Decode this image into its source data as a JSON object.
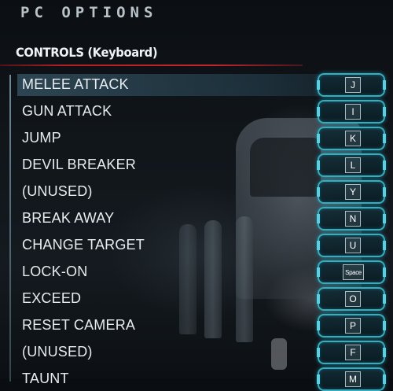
{
  "header": {
    "title": "PC OPTIONS",
    "section": "CONTROLS (Keyboard)"
  },
  "colors": {
    "accent_cyan": "#2fb0c4",
    "section_underline_red": "#c4262e",
    "selected_row": "#46778c"
  },
  "controls": {
    "rows": [
      {
        "action": "MELEE ATTACK",
        "key": "J",
        "selected": true
      },
      {
        "action": "GUN ATTACK",
        "key": "I"
      },
      {
        "action": "JUMP",
        "key": "K"
      },
      {
        "action": "DEVIL BREAKER",
        "key": "L"
      },
      {
        "action": "(UNUSED)",
        "key": "Y"
      },
      {
        "action": "BREAK AWAY",
        "key": "N"
      },
      {
        "action": "CHANGE TARGET",
        "key": "U"
      },
      {
        "action": "LOCK-ON",
        "key": "Space"
      },
      {
        "action": "EXCEED",
        "key": "O"
      },
      {
        "action": "RESET CAMERA",
        "key": "P"
      },
      {
        "action": "(UNUSED)",
        "key": "F"
      },
      {
        "action": "TAUNT",
        "key": "M"
      }
    ]
  }
}
